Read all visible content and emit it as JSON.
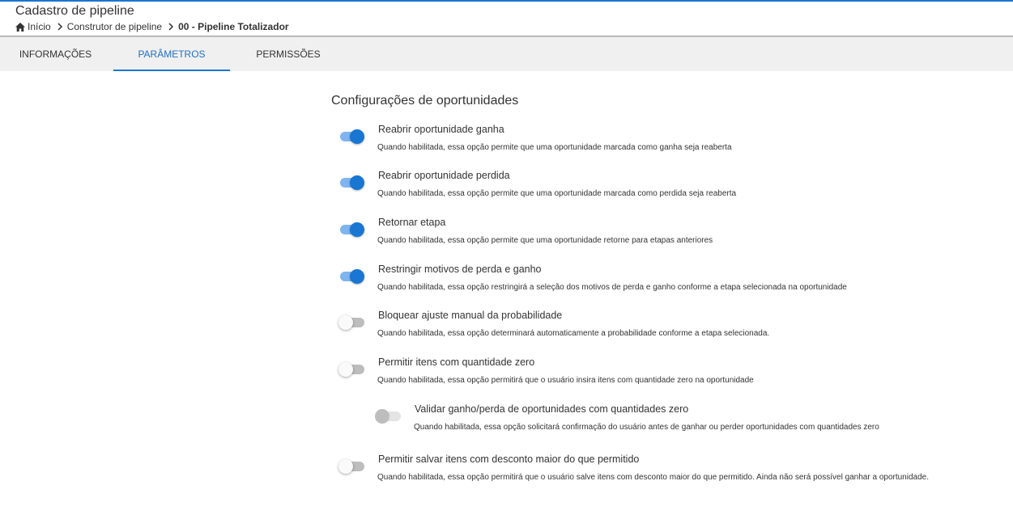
{
  "header": {
    "title": "Cadastro de pipeline",
    "breadcrumb": [
      "Início",
      "Construtor de pipeline",
      "00 - Pipeline Totalizador"
    ]
  },
  "tabs": [
    {
      "label": "INFORMAÇÕES"
    },
    {
      "label": "PARÂMETROS",
      "active": true
    },
    {
      "label": "PERMISSÕES"
    }
  ],
  "section": {
    "title": "Configurações de oportunidades",
    "options": [
      {
        "label": "Reabrir oportunidade ganha",
        "description": "Quando habilitada, essa opção permite que uma oportunidade marcada como ganha seja reaberta",
        "enabled": true
      },
      {
        "label": "Reabrir oportunidade perdida",
        "description": "Quando habilitada, essa opção permite que uma oportunidade marcada como perdida seja reaberta",
        "enabled": true
      },
      {
        "label": "Retornar etapa",
        "description": "Quando habilitada, essa opção permite que uma oportunidade retorne para etapas anteriores",
        "enabled": true
      },
      {
        "label": "Restringir motivos de perda e ganho",
        "description": "Quando habilitada, essa opção restringirá a seleção dos motivos de perda e ganho conforme a etapa selecionada na oportunidade",
        "enabled": true
      },
      {
        "label": "Bloquear ajuste manual da probabilidade",
        "description": "Quando habilitada, essa opção determinará automaticamente a probabilidade conforme a etapa selecionada.",
        "enabled": false
      },
      {
        "label": "Permitir itens com quantidade zero",
        "description": "Quando habilitada, essa opção permitirá que o usuário insira itens com quantidade zero na oportunidade",
        "enabled": false
      },
      {
        "label": "Validar ganho/perda de oportunidades com quantidades zero",
        "description": "Quando habilitada, essa opção solicitará confirmação do usuário antes de ganhar ou perder oportunidades com quantidades zero",
        "enabled": false,
        "disabled": true
      },
      {
        "label": "Permitir salvar itens com desconto maior do que permitido",
        "description": "Quando habilitada, essa opção permitirá que o usuário salve itens com desconto maior do que permitido. Ainda não será possível ganhar a oportunidade.",
        "enabled": false
      }
    ]
  },
  "colors": {
    "accent": "#1976d2",
    "toggle_track_on": "#7fb4ef",
    "tab_bar": "#f0f0f0"
  }
}
